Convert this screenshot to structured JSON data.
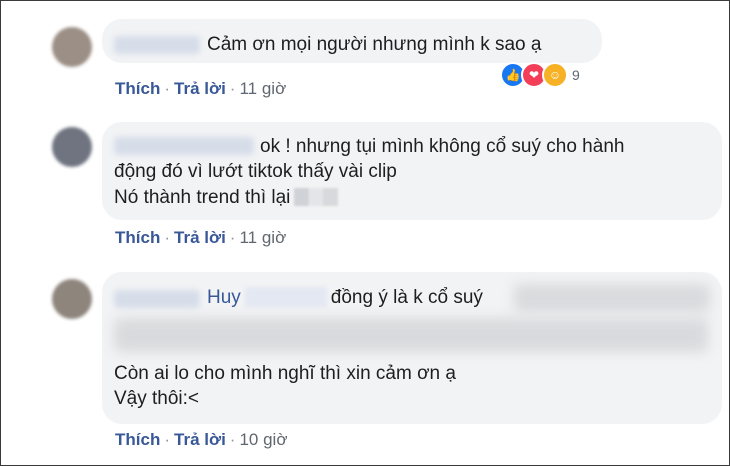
{
  "comments": [
    {
      "text_lines": [
        "Cảm ơn mọi người nhưng mình k sao ạ"
      ],
      "actions": {
        "like": "Thích",
        "reply": "Trả lời",
        "time": "11 giờ"
      },
      "reactions": {
        "count": "9",
        "icons": [
          "like-icon",
          "love-icon",
          "care-icon"
        ]
      }
    },
    {
      "text_lines": [
        "ok ! nhưng tụi mình không cổ suý cho hành",
        "động đó vì lướt tiktok thấy vài clip",
        "Nó thành trend thì lại"
      ],
      "actions": {
        "like": "Thích",
        "reply": "Trả lời",
        "time": "11 giờ"
      }
    },
    {
      "mention": "Huy",
      "mention_suffix": "đồng ý là k cổ suý",
      "text_lines": [
        "Còn ai lo cho mình nghĩ thì xin cảm ơn ạ",
        "Vậy thôi:<"
      ],
      "actions": {
        "like": "Thích",
        "reply": "Trả lời",
        "time": "10 giờ"
      }
    }
  ],
  "colors": {
    "link": "#385898",
    "bubble": "#f2f3f5",
    "like": "#1877f2",
    "love": "#f33e58",
    "care": "#f7b125"
  }
}
